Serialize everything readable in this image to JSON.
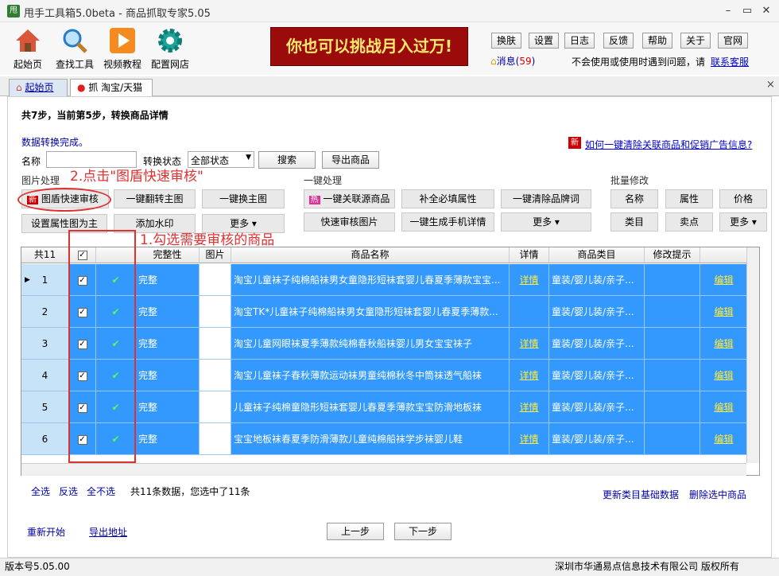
{
  "window": {
    "title": "甩手工具箱5.0beta - 商品抓取专家5.05",
    "app_icon": "甩"
  },
  "toolbar": {
    "items": [
      {
        "label": "起始页",
        "icon": "house-icon"
      },
      {
        "label": "查找工具",
        "icon": "magnifier-icon"
      },
      {
        "label": "视频教程",
        "icon": "play-icon"
      },
      {
        "label": "配置网店",
        "icon": "gear-icon"
      }
    ]
  },
  "banner": "你也可以挑战月入过万!",
  "top_buttons": [
    "换肤",
    "设置",
    "日志",
    "反馈",
    "帮助",
    "关于",
    "官网"
  ],
  "messages": {
    "label": "消息(",
    "count": "59",
    "close": ")"
  },
  "help_text": "不会使用或使用时遇到问题，请",
  "contact_link": "联系客服",
  "tabs": {
    "home": "起始页",
    "grab": "抓 淘宝/天猫"
  },
  "steps": "共7步，当前第5步，转换商品详情",
  "conversion_done": "数据转换完成。",
  "clear_badge": "新",
  "clear_link": "如何一键清除关联商品和促销广告信息?",
  "filter": {
    "name_label": "名称",
    "status_label": "转换状态",
    "status_value": "全部状态",
    "search_btn": "搜索",
    "export_btn": "导出商品"
  },
  "image_section": {
    "title": "图片处理",
    "new_badge": "新",
    "quick_review": "图盾快速审核",
    "flip": "一键翻转主图",
    "replace": "一键换主图",
    "set_attr": "设置属性图为主",
    "watermark": "添加水印",
    "more": "更多"
  },
  "one_click": {
    "title": "一键处理",
    "hot_badge": "热",
    "related": "一键关联源商品",
    "fill": "补全必填属性",
    "clear_brand": "一键清除品牌词",
    "review_img": "快速审核图片",
    "mobile": "一键生成手机详情",
    "more": "更多"
  },
  "batch": {
    "title": "批量修改",
    "name": "名称",
    "attr": "属性",
    "price": "价格",
    "category": "类目",
    "selling": "卖点",
    "more": "更多"
  },
  "annotations": {
    "step2": "2.点击\"图盾快速审核\"",
    "step1": "1.勾选需要审核的商品"
  },
  "table": {
    "total": "共11",
    "headers": [
      "完整性",
      "图片",
      "商品名称",
      "详情",
      "商品类目",
      "修改提示"
    ],
    "rows": [
      {
        "no": "1",
        "status": "完整",
        "name": "淘宝儿童袜子纯棉船袜男女童隐形短袜套婴儿春夏季薄款宝宝...",
        "detail": "详情",
        "category": "童装/婴儿装/亲子...",
        "edit": "编辑"
      },
      {
        "no": "2",
        "status": "完整",
        "name": "淘宝TK*儿童袜子纯棉船袜男女童隐形短袜套婴儿春夏季薄款...",
        "detail": "",
        "category": "童装/婴儿装/亲子...",
        "edit": "编辑"
      },
      {
        "no": "3",
        "status": "完整",
        "name": "淘宝儿童网眼袜夏季薄款纯棉春秋船袜婴儿男女宝宝袜子",
        "detail": "详情",
        "category": "童装/婴儿装/亲子...",
        "edit": "编辑"
      },
      {
        "no": "4",
        "status": "完整",
        "name": "淘宝儿童袜子春秋薄款运动袜男童纯棉秋冬中筒袜透气船袜",
        "detail": "详情",
        "category": "童装/婴儿装/亲子...",
        "edit": "编辑"
      },
      {
        "no": "5",
        "status": "完整",
        "name": "儿童袜子纯棉童隐形短袜套婴儿春夏季薄款宝宝防滑地板袜",
        "detail": "详情",
        "category": "童装/婴儿装/亲子...",
        "edit": "编辑"
      },
      {
        "no": "6",
        "status": "完整",
        "name": "宝宝地板袜春夏季防滑薄款儿童纯棉船袜学步袜婴儿鞋",
        "detail": "详情",
        "category": "童装/婴儿装/亲子...",
        "edit": "编辑"
      }
    ]
  },
  "selection": {
    "select_all": "全选",
    "invert": "反选",
    "select_none": "全不选",
    "summary": "共11条数据，您选中了11条"
  },
  "bottom_links": {
    "update": "更新类目基础数据",
    "delete": "删除选中商品"
  },
  "nav": {
    "restart": "重新开始",
    "export_addr": "导出地址",
    "prev": "上一步",
    "next": "下一步"
  },
  "status": {
    "version": "版本号5.05.00",
    "copyright": "深圳市华通易点信息技术有限公司 版权所有"
  }
}
